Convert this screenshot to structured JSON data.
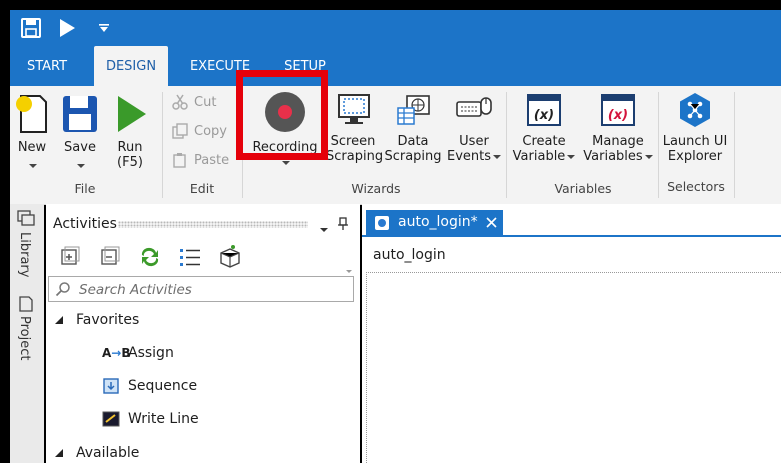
{
  "tabs": [
    "START",
    "DESIGN",
    "EXECUTE",
    "SETUP"
  ],
  "ribbon": {
    "file": {
      "new": "New",
      "save": "Save",
      "run": "Run",
      "run_key": "(F5)",
      "group": "File"
    },
    "edit": {
      "cut": "Cut",
      "copy": "Copy",
      "paste": "Paste",
      "group": "Edit"
    },
    "wizards": {
      "recording": "Recording",
      "screen_1": "Screen",
      "screen_2": "Scraping",
      "data_1": "Data",
      "data_2": "Scraping",
      "user_1": "User",
      "user_2": "Events",
      "group": "Wizards"
    },
    "variables": {
      "create_1": "Create",
      "create_2": "Variable",
      "manage_1": "Manage",
      "manage_2": "Variables",
      "group": "Variables"
    },
    "selectors": {
      "launch_1": "Launch UI",
      "launch_2": "Explorer",
      "group": "Selectors"
    }
  },
  "side_tabs": [
    "Library",
    "Project"
  ],
  "activities": {
    "title": "Activities",
    "search_placeholder": "Search Activities",
    "favorites": "Favorites",
    "items": [
      "Assign",
      "Sequence",
      "Write Line"
    ],
    "available": "Available",
    "assign_icon_text": "A",
    "assign_icon_text2": "B"
  },
  "document": {
    "tab_title": "auto_login*",
    "heading": "auto_login"
  },
  "colors": {
    "brand_blue": "#1c74c8",
    "highlight_red": "#e5000a",
    "run_green": "#3a9a2a"
  }
}
